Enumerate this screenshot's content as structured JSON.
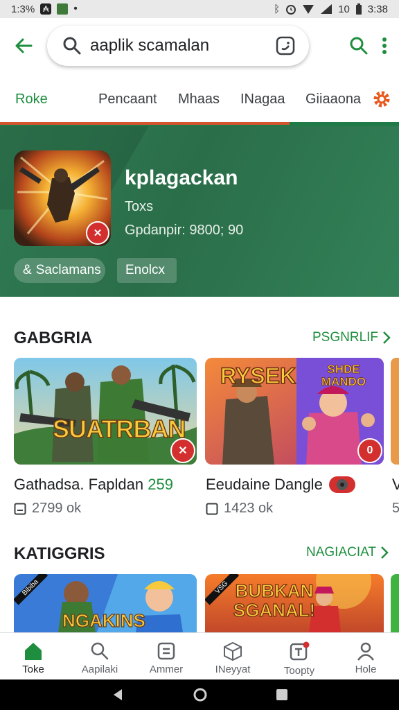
{
  "status_bar": {
    "time_left": "1:3%",
    "time_right": "3:38",
    "battery": "10"
  },
  "search": {
    "value": "aaplik scamalan"
  },
  "tabs": [
    {
      "label": "Roke",
      "active": true
    },
    {
      "label": "Pencaant",
      "active": false
    },
    {
      "label": "Mhaas",
      "active": false
    },
    {
      "label": "INagaa",
      "active": false
    },
    {
      "label": "Giiaaona",
      "active": false
    }
  ],
  "hero": {
    "title": "kplagackan",
    "subtitle": "Toxs",
    "meta": "Gpdanpir: 9800; 90",
    "chip1": "Saclamans",
    "chip2": "Enolcx"
  },
  "section1": {
    "title": "GABGRIA",
    "more": "PSGNRLIF",
    "cards": [
      {
        "banner": "SUATRBAN",
        "label": "Gathadsa. Fapldan",
        "label_num": "259",
        "meta": "2799 ok"
      },
      {
        "banner": "RYSEK",
        "banner2": "SHDE MANDO",
        "label": "Eeudaine Dangle",
        "meta": "1423 ok"
      }
    ],
    "cut_card_label": "V",
    "cut_card_meta": "5"
  },
  "section2": {
    "title": "KATIGGRIS",
    "more": "NAGIACIAT",
    "cards": [
      {
        "banner": "NGAKINS",
        "ribbon": "Bibiba"
      },
      {
        "banner": "BUBKAN SGANAL!",
        "ribbon": "VSG"
      }
    ]
  },
  "bottom_nav": [
    {
      "label": "Toke",
      "icon": "home-icon",
      "active": true
    },
    {
      "label": "Aapilaki",
      "icon": "search-icon",
      "active": false
    },
    {
      "label": "Ammer",
      "icon": "apps-icon",
      "active": false
    },
    {
      "label": "INeyyat",
      "icon": "box-icon",
      "active": false
    },
    {
      "label": "Toopty",
      "icon": "games-icon",
      "active": false
    },
    {
      "label": "Hole",
      "icon": "person-icon",
      "active": false
    }
  ],
  "colors": {
    "accent_green": "#1e8e3e",
    "hero_green": "#2f7a52",
    "badge_red": "#d32f2f",
    "tab_underline": "#d2552f"
  }
}
